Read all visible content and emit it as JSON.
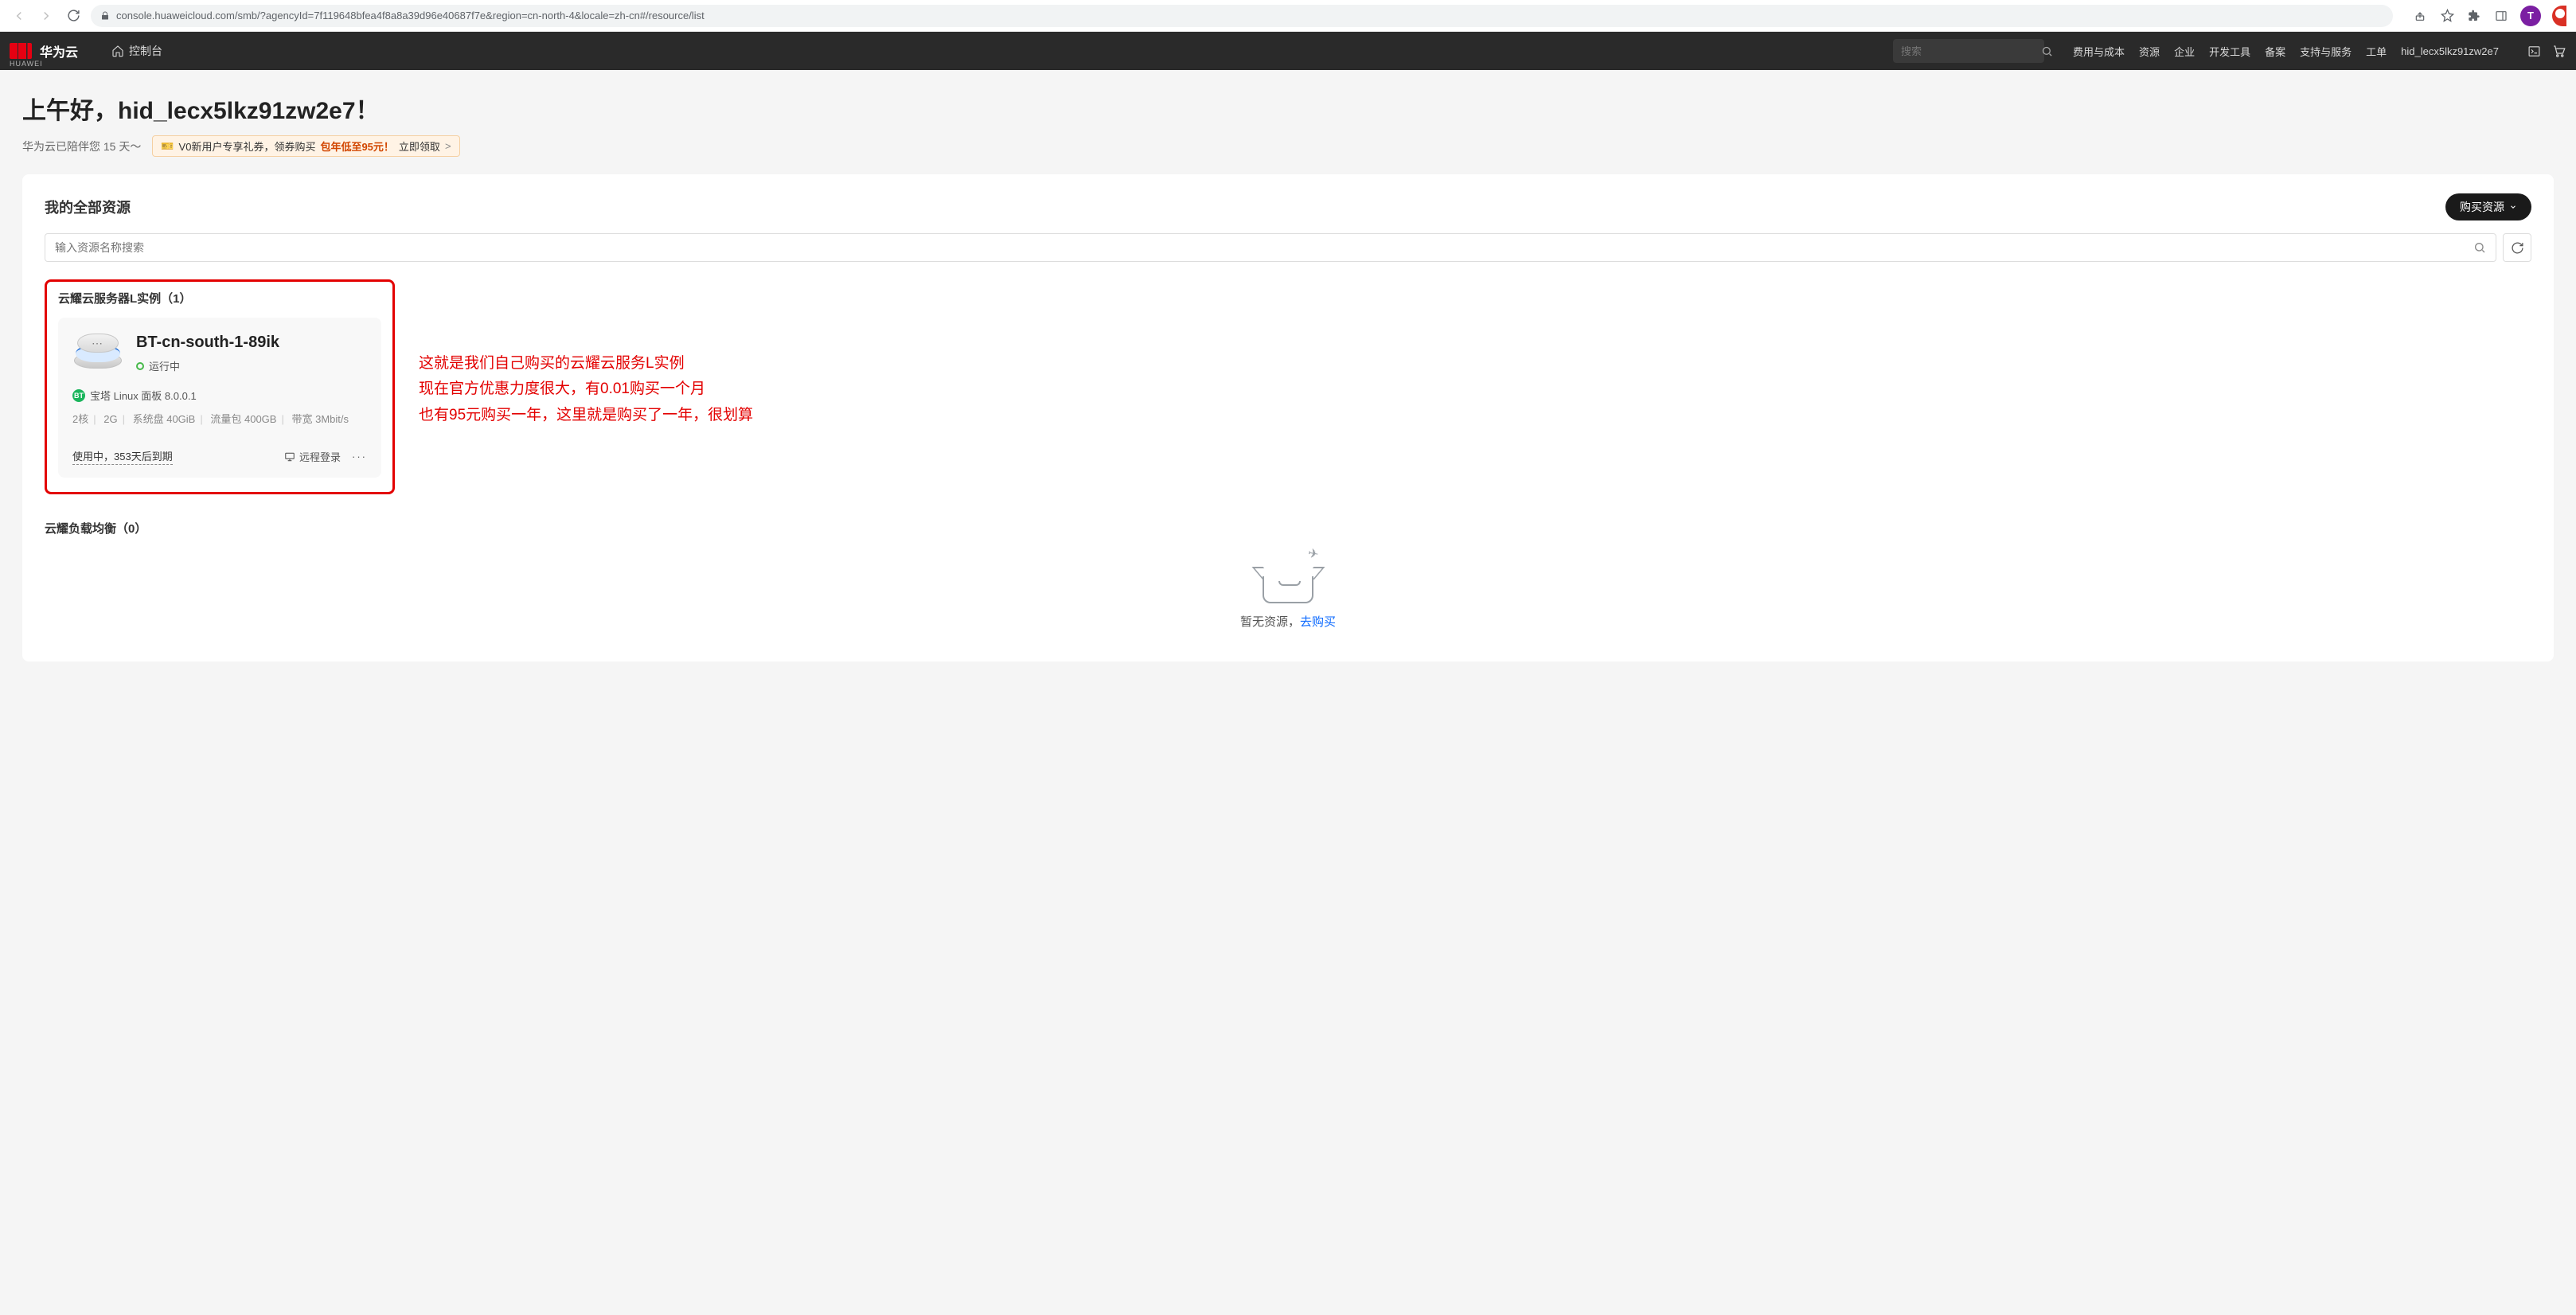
{
  "browser": {
    "url": "console.huaweicloud.com/smb/?agencyId=7f119648bfea4f8a8a39d96e40687f7e&region=cn-north-4&locale=zh-cn#/resource/list",
    "profile_initial": "T"
  },
  "header": {
    "brand_sub": "HUAWEI",
    "brand": "华为云",
    "console": "控制台",
    "search_placeholder": "搜索",
    "nav": {
      "cost": "费用与成本",
      "resources": "资源",
      "enterprise": "企业",
      "devtools": "开发工具",
      "beian": "备案",
      "support": "支持与服务",
      "tickets": "工单"
    },
    "username": "hid_lecx5lkz91zw2e7"
  },
  "greeting": {
    "title": "上午好，hid_lecx5lkz91zw2e7！",
    "sub": "华为云已陪伴您 15 天～",
    "promo_tag": "🎫",
    "promo_prefix": "V0新用户专享礼券，领券购买",
    "promo_highlight": " 包年低至95元！",
    "promo_link": " 立即领取",
    "promo_chev": " >"
  },
  "panel": {
    "title": "我的全部资源",
    "buy_label": "购买资源",
    "search_placeholder": "输入资源名称搜索"
  },
  "section1": {
    "title": "云耀云服务器L实例（1）",
    "card": {
      "name": "BT-cn-south-1-89ik",
      "status": "运行中",
      "bt_label": "宝塔 Linux 面板 8.0.0.1",
      "bt_badge": "BT",
      "spec_cpu": "2核",
      "spec_mem": "2G",
      "spec_disk": "系统盘 40GiB",
      "spec_traffic": "流量包 400GB",
      "spec_bw": "带宽 3Mbit/s",
      "expire": "使用中，353天后到期",
      "remote_login": "远程登录"
    },
    "annotation_l1": "这就是我们自己购买的云耀云服务L实例",
    "annotation_l2": "现在官方优惠力度很大，有0.01购买一个月",
    "annotation_l3": "也有95元购买一年，这里就是购买了一年，很划算"
  },
  "section2": {
    "title": "云耀负载均衡（0）",
    "empty_text": "暂无资源，",
    "go_link": "去购买"
  }
}
